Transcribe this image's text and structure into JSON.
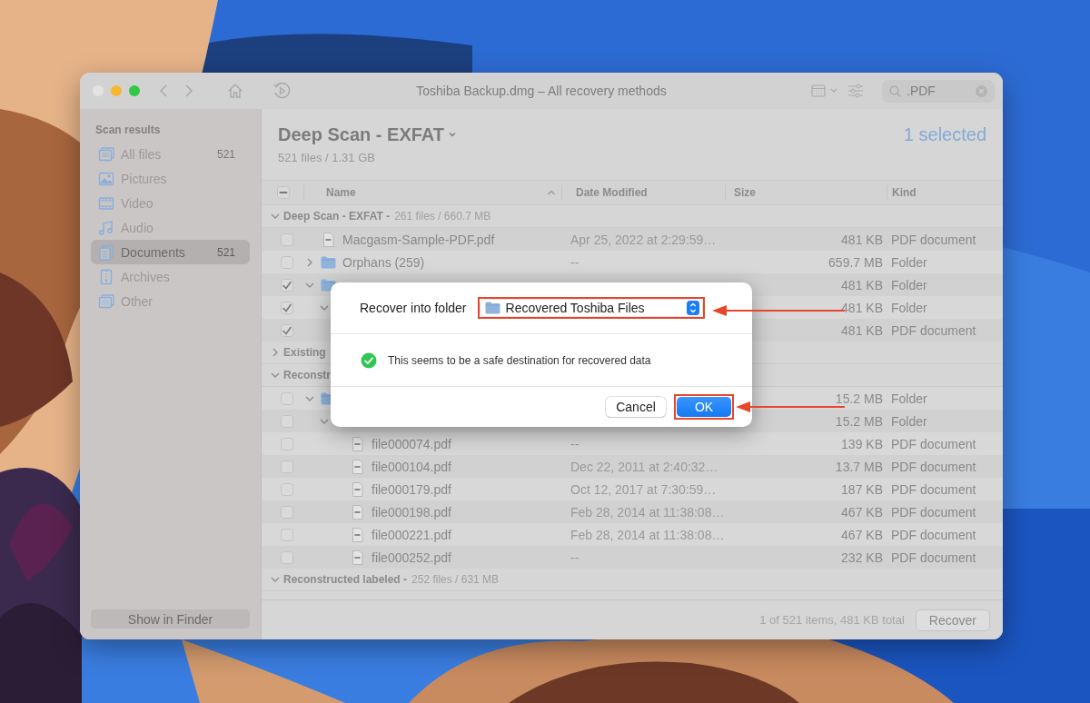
{
  "window": {
    "title": "Toshiba Backup.dmg – All recovery methods",
    "search": {
      "value": ".PDF"
    }
  },
  "sidebar": {
    "heading": "Scan results",
    "items": [
      {
        "label": "All files",
        "count": "521",
        "selected": false
      },
      {
        "label": "Pictures",
        "selected": false
      },
      {
        "label": "Video",
        "selected": false
      },
      {
        "label": "Audio",
        "selected": false
      },
      {
        "label": "Documents",
        "count": "521",
        "selected": true
      },
      {
        "label": "Archives",
        "selected": false
      },
      {
        "label": "Other",
        "selected": false
      }
    ],
    "button": "Show in Finder"
  },
  "content": {
    "title": "Deep Scan - EXFAT",
    "subtitle": "521 files / 1.31 GB",
    "selection": "1 selected"
  },
  "table": {
    "select_all_mixed": true,
    "columns": [
      "Name",
      "Date Modified",
      "Size",
      "Kind"
    ],
    "groups": [
      {
        "title": "Deep Scan - EXFAT -",
        "detail": "261 files / 660.7 MB",
        "expanded": true,
        "rows": [
          {
            "kind": "file",
            "name": "Macgasm-Sample-PDF.pdf",
            "date": "Apr 25, 2022 at 2:29:59…",
            "size": "481 KB",
            "file_type": "PDF document",
            "checked": false
          },
          {
            "kind": "folder",
            "name": "Orphans (259)",
            "date": "--",
            "size": "659.7 MB",
            "file_type": "Folder",
            "checked": false,
            "expanded": false
          },
          {
            "kind": "folder",
            "size": "481 KB",
            "file_type": "Folder",
            "checked": true,
            "expanded": true,
            "children": [
              {
                "size": "481 KB",
                "file_type": "Folder",
                "checked": true,
                "expanded": true,
                "children": [
                  {
                    "size": "481 KB",
                    "file_type": "PDF document",
                    "checked": true
                  }
                ]
              }
            ]
          }
        ]
      },
      {
        "title": "Existing",
        "expanded": false
      },
      {
        "title": "Reconstr",
        "expanded": true,
        "rows": [
          {
            "kind": "folder",
            "size": "15.2 MB",
            "file_type": "Folder",
            "checked": false,
            "expanded": true,
            "children": [
              {
                "size": "15.2 MB",
                "file_type": "Folder",
                "checked": false,
                "expanded": true,
                "children": [
                  {
                    "kind": "file",
                    "name": "file000074.pdf",
                    "date": "--",
                    "size": "139 KB",
                    "file_type": "PDF document",
                    "checked": false
                  },
                  {
                    "kind": "file",
                    "name": "file000104.pdf",
                    "date": "Dec 22, 2011 at 2:40:32…",
                    "size": "13.7 MB",
                    "file_type": "PDF document",
                    "checked": false
                  },
                  {
                    "kind": "file",
                    "name": "file000179.pdf",
                    "date": "Oct 12, 2017 at 7:30:59…",
                    "size": "187 KB",
                    "file_type": "PDF document",
                    "checked": false
                  },
                  {
                    "kind": "file",
                    "name": "file000198.pdf",
                    "date": "Feb 28, 2014 at 11:38:08…",
                    "size": "467 KB",
                    "file_type": "PDF document",
                    "checked": false
                  },
                  {
                    "kind": "file",
                    "name": "file000221.pdf",
                    "date": "Feb 28, 2014 at 11:38:08…",
                    "size": "467 KB",
                    "file_type": "PDF document",
                    "checked": false
                  },
                  {
                    "kind": "file",
                    "name": "file000252.pdf",
                    "date": "--",
                    "size": "232 KB",
                    "file_type": "PDF document",
                    "checked": false
                  }
                ]
              }
            ]
          }
        ]
      },
      {
        "title": "Reconstructed labeled -",
        "detail": "252 files / 631 MB",
        "expanded": true
      }
    ]
  },
  "footer": {
    "status": "1 of 521 items, 481 KB total",
    "button": "Recover"
  },
  "dialog": {
    "label": "Recover into folder",
    "folder": "Recovered Toshiba Files",
    "message": "This seems to be a safe destination for recovered data",
    "buttons": [
      {
        "label": "Cancel",
        "default": false
      },
      {
        "label": "OK",
        "default": true
      }
    ]
  }
}
